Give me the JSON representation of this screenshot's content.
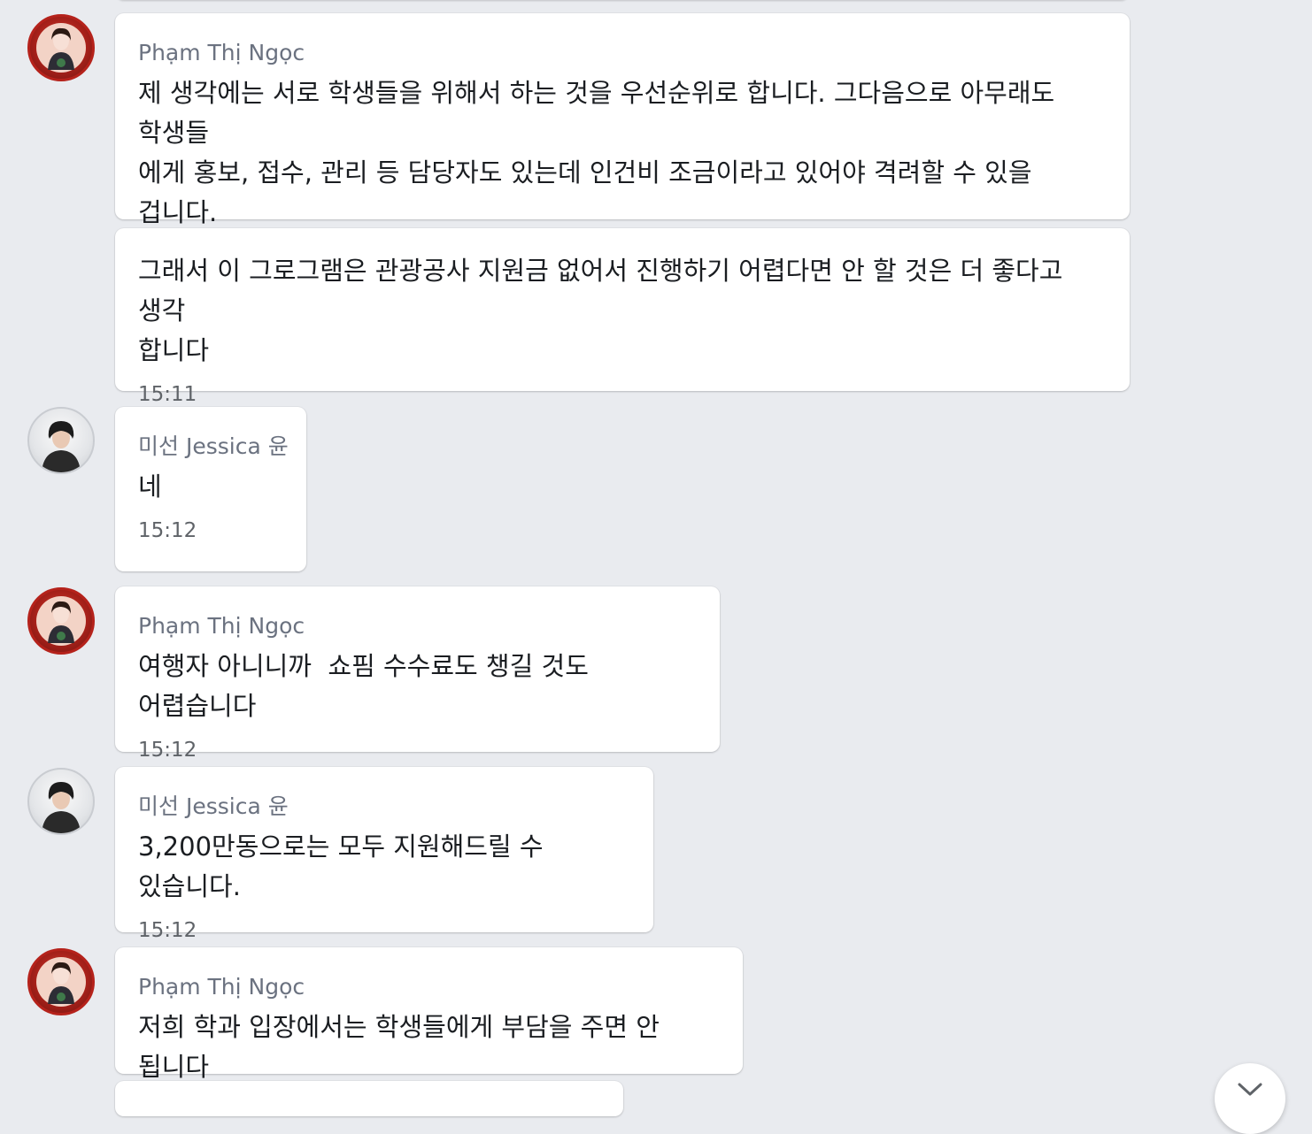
{
  "messages": [
    {
      "sender": "Phạm Thị Ngọc",
      "text": "제 생각에는 서로 학생들을 위해서 하는 것을 우선순위로 합니다. 그다음으로 아무래도 학생들\n에게 홍보, 접수, 관리 등 담당자도 있는데 인건비 조금이라고 있어야 격려할 수 있을 겁니다.\n또는 학교 관리급 무시할 수 없으니까요"
    },
    {
      "text": "그래서 이 그로그램은 관광공사 지원금 없어서 진행하기 어렵다면 안 할 것은 더 좋다고 생각\n합니다",
      "time": "15:11"
    },
    {
      "sender": "미선 Jessica 윤",
      "text": "네",
      "time": "15:12"
    },
    {
      "sender": "Phạm Thị Ngọc",
      "text": "여행자 아니니까  쇼핌 수수료도 챙길 것도 어렵습니다",
      "time": "15:12"
    },
    {
      "sender": "미선 Jessica 윤",
      "text": "3,200만동으로는 모두 지원해드릴 수 있습니다.",
      "time": "15:12"
    },
    {
      "sender": "Phạm Thị Ngọc",
      "text": "저희 학과 입장에서는 학생들에게 부담을 주면 안 됩니다"
    }
  ],
  "icons": {
    "scroll_down": "chevron-down-icon"
  },
  "colors": {
    "background": "#e9ebef",
    "bubble": "#ffffff",
    "sender_text": "#6b7280"
  }
}
